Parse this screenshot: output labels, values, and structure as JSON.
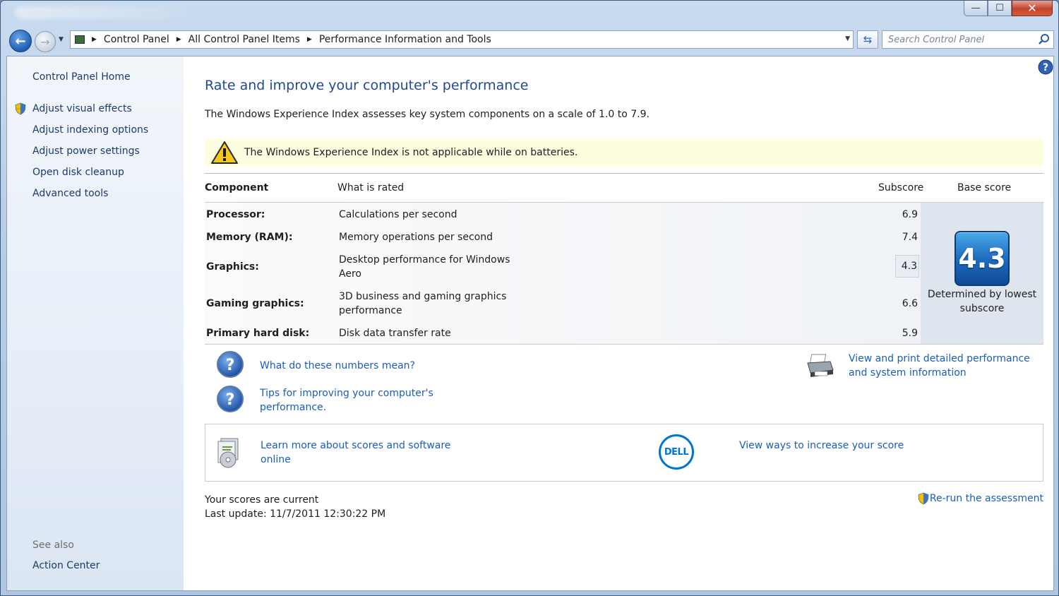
{
  "window": {
    "controls": {
      "minimize": "—",
      "maximize": "☐",
      "close": "✕"
    }
  },
  "nav": {
    "back_icon": "back-arrow-icon",
    "forward_icon": "forward-arrow-icon",
    "breadcrumbs": [
      "Control Panel",
      "All Control Panel Items",
      "Performance Information and Tools"
    ],
    "search_placeholder": "Search Control Panel"
  },
  "sidebar": {
    "home": "Control Panel Home",
    "tasks": [
      {
        "label": "Adjust visual effects",
        "shield": true
      },
      {
        "label": "Adjust indexing options",
        "shield": false
      },
      {
        "label": "Adjust power settings",
        "shield": false
      },
      {
        "label": "Open disk cleanup",
        "shield": false
      },
      {
        "label": "Advanced tools",
        "shield": false
      }
    ],
    "see_also_heading": "See also",
    "see_also": [
      "Action Center"
    ]
  },
  "main": {
    "title": "Rate and improve your computer's performance",
    "intro": "The Windows Experience Index assesses key system components on a scale of 1.0 to 7.9.",
    "warning": "The Windows Experience Index is not applicable while on batteries.",
    "table": {
      "headers": {
        "component": "Component",
        "what": "What is rated",
        "subscore": "Subscore",
        "base": "Base score"
      },
      "rows": [
        {
          "component": "Processor:",
          "what": "Calculations per second",
          "subscore": "6.9"
        },
        {
          "component": "Memory (RAM):",
          "what": "Memory operations per second",
          "subscore": "7.4"
        },
        {
          "component": "Graphics:",
          "what": "Desktop performance for Windows Aero",
          "subscore": "4.3"
        },
        {
          "component": "Gaming graphics:",
          "what": "3D business and gaming graphics performance",
          "subscore": "6.6"
        },
        {
          "component": "Primary hard disk:",
          "what": "Disk data transfer rate",
          "subscore": "5.9"
        }
      ],
      "base_score": "4.3",
      "base_caption": "Determined by lowest subscore"
    },
    "links": {
      "numbers_meaning": "What do these numbers mean?",
      "tips": "Tips for improving your computer's performance.",
      "print_details": "View and print detailed performance and system information",
      "learn_more": "Learn more about scores and software online",
      "increase_score": "View ways to increase your score",
      "rerun": "Re-run the assessment"
    },
    "brand_logo_text": "DELL",
    "status": {
      "current": "Your scores are current",
      "last_update": "Last update: 11/7/2011 12:30:22 PM"
    }
  }
}
